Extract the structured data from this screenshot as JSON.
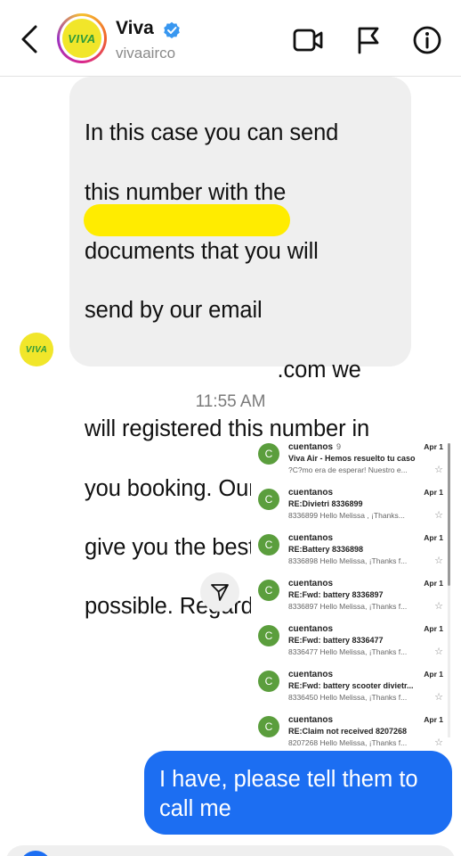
{
  "header": {
    "contact_name": "Viva",
    "username": "vivaairco",
    "avatar_logo": "VIVA",
    "verified": true,
    "icons": [
      "back-icon",
      "video-call-icon",
      "flag-icon",
      "info-icon"
    ]
  },
  "incoming_message": {
    "lines": [
      "In this case you can send",
      "this number with the",
      "documents that you will",
      "send by our email",
      "                               .com we",
      "will registered this number in",
      "you booking. Our purpose is",
      "give you the best attention",
      "possible. Regards. ✈️💛💎"
    ],
    "sender_avatar_logo": "VIVA"
  },
  "timestamp": "11:55 AM",
  "shared_screenshot": {
    "emails": [
      {
        "sender": "cuentanos",
        "count": "9",
        "date": "Apr 1",
        "subject": "Viva Air - Hemos resuelto tu caso",
        "snippet": "?C?mo era de esperar! Nuestro e..."
      },
      {
        "sender": "cuentanos",
        "count": "",
        "date": "Apr 1",
        "subject": "RE:Divietri 8336899",
        "snippet": "8336899 Hello Melissa , ¡Thanks..."
      },
      {
        "sender": "cuentanos",
        "count": "",
        "date": "Apr 1",
        "subject": "RE:Battery 8336898",
        "snippet": "8336898 Hello Melissa, ¡Thanks f..."
      },
      {
        "sender": "cuentanos",
        "count": "",
        "date": "Apr 1",
        "subject": "RE:Fwd: battery 8336897",
        "snippet": "8336897 Hello Melissa, ¡Thanks f..."
      },
      {
        "sender": "cuentanos",
        "count": "",
        "date": "Apr 1",
        "subject": "RE:Fwd: battery 8336477",
        "snippet": "8336477 Hello Melissa, ¡Thanks f..."
      },
      {
        "sender": "cuentanos",
        "count": "",
        "date": "Apr 1",
        "subject": "RE:Fwd: battery scooter divietr...",
        "snippet": "8336450 Hello Melissa, ¡Thanks f..."
      },
      {
        "sender": "cuentanos",
        "count": "",
        "date": "Apr 1",
        "subject": "RE:Claim not received 8207268",
        "snippet": "8207268 Hello Melissa, ¡Thanks f..."
      }
    ],
    "avatar_letter": "C"
  },
  "outgoing_message": {
    "text": "I have, please tell them to call me"
  },
  "colors": {
    "outgoing_bubble": "#1c6ef2",
    "incoming_bubble": "#efefef",
    "redaction": "#ffec00",
    "brand_yellow": "#f1e62a",
    "brand_green": "#2e9a3b"
  }
}
